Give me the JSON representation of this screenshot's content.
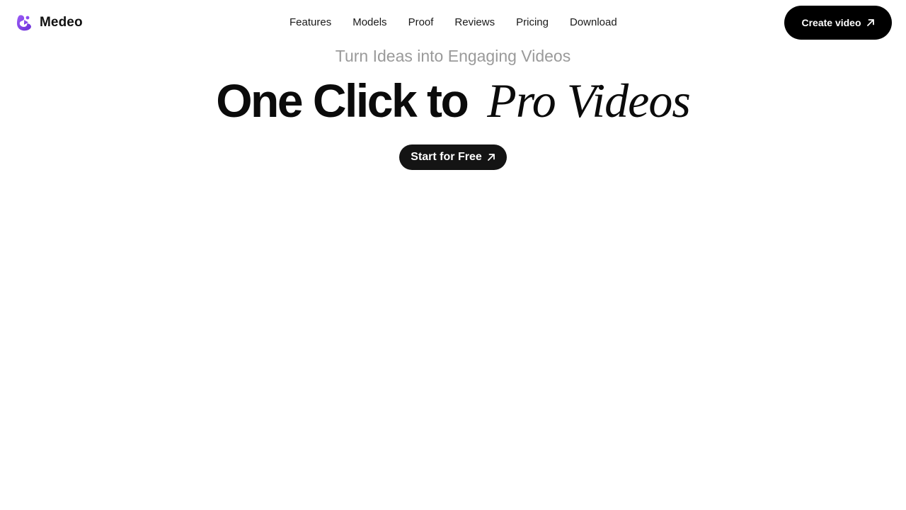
{
  "brand": {
    "name": "Medeo",
    "logo_icon": "medeo-logo-icon",
    "logo_color": "#7b3fe4"
  },
  "nav": {
    "items": [
      {
        "label": "Features"
      },
      {
        "label": "Models"
      },
      {
        "label": "Proof"
      },
      {
        "label": "Reviews"
      },
      {
        "label": "Pricing"
      },
      {
        "label": "Download"
      }
    ]
  },
  "header_cta": {
    "label": "Create video",
    "icon": "arrow-up-right-icon",
    "background": "#000000"
  },
  "hero": {
    "tagline": "Turn Ideas into Engaging Videos",
    "title_bold": "One Click to",
    "title_italic": "Pro Videos",
    "cta_label": "Start for Free",
    "cta_icon": "arrow-up-right-icon",
    "tagline_color": "#9a9a9a"
  }
}
